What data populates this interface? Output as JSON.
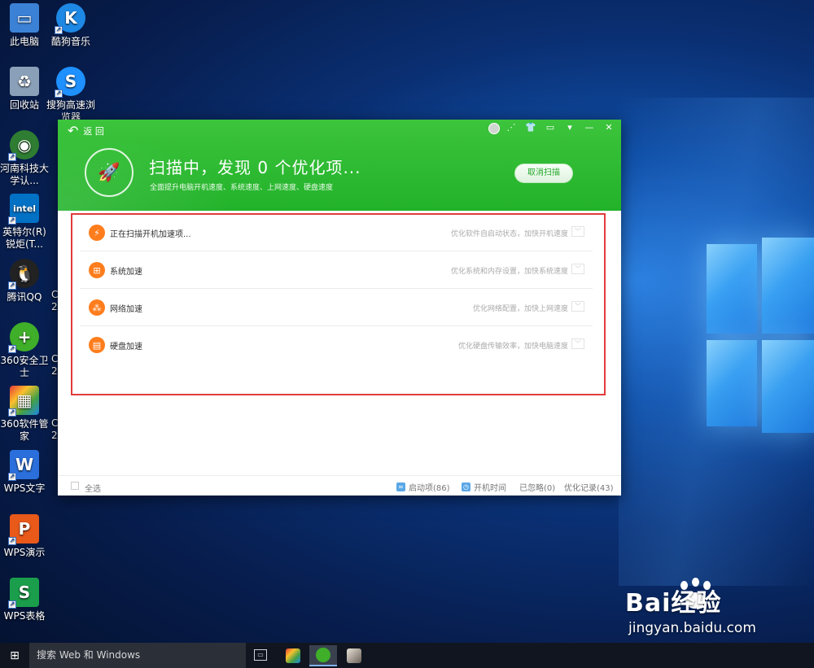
{
  "desktop": {
    "icons": [
      {
        "label": "此电脑",
        "icon": "computer-icon",
        "color": "#3b82d6"
      },
      {
        "label": "酷狗音乐",
        "icon": "kugou-icon",
        "color": "#1e88e5"
      },
      {
        "label": "回收站",
        "icon": "recycle-bin-icon",
        "color": "#8aa0b8"
      },
      {
        "label": "搜狗高速浏览器",
        "icon": "sogou-browser-icon",
        "color": "#1e90ff"
      },
      {
        "label": "河南科技大学认...",
        "icon": "network-icon",
        "color": "#2e7d32"
      },
      {
        "label": "英特尔(R) 锐炬(T...",
        "icon": "intel-icon",
        "color": "#0071c5"
      },
      {
        "label": "腾讯QQ",
        "icon": "qq-icon",
        "color": "#222222"
      },
      {
        "label": "360安全卫士",
        "icon": "360-safe-icon",
        "color": "#3fae29"
      },
      {
        "label": "360软件管家",
        "icon": "360-software-icon",
        "color": "#e53935"
      },
      {
        "label": "WPS文字",
        "icon": "wps-writer-icon",
        "color": "#2a6fdb"
      },
      {
        "label": "WPS演示",
        "icon": "wps-presentation-icon",
        "color": "#e8591a"
      },
      {
        "label": "WPS表格",
        "icon": "wps-spreadsheet-icon",
        "color": "#1a9e4b"
      }
    ],
    "clipped_labels": [
      "C",
      "2(",
      "C",
      "2(",
      "C",
      "2("
    ]
  },
  "app": {
    "back_label": "返 回",
    "scan_title": "扫描中，发现 0 个优化项...",
    "scan_subtitle": "全面提升电脑开机速度、系统速度、上网速度、硬盘速度",
    "cancel_label": "取消扫描",
    "toolbar_icons": [
      "share-icon",
      "skin-icon",
      "feedback-icon",
      "menu-icon",
      "minimize-icon",
      "close-icon"
    ],
    "rows": [
      {
        "name": "正在扫描开机加速项...",
        "desc": "优化软件自启动状态，加快开机速度",
        "icon": "lightning-icon"
      },
      {
        "name": "系统加速",
        "desc": "优化系统和内存设置，加快系统速度",
        "icon": "windows-icon"
      },
      {
        "name": "网络加速",
        "desc": "优化网络配置，加快上网速度",
        "icon": "network-nodes-icon"
      },
      {
        "name": "硬盘加速",
        "desc": "优化硬盘传输效率，加快电脑速度",
        "icon": "disk-icon"
      }
    ],
    "footer": {
      "select_all": "全选",
      "startup_items": "启动项(86)",
      "boot_time": "开机时间",
      "ignored": "已忽略(0)",
      "history": "优化记录(43)"
    },
    "accent": "#22b22a"
  },
  "taskbar": {
    "search_placeholder": "搜索 Web 和 Windows"
  },
  "watermark": {
    "brand": "Bai经验",
    "url": "jingyan.baidu.com"
  }
}
